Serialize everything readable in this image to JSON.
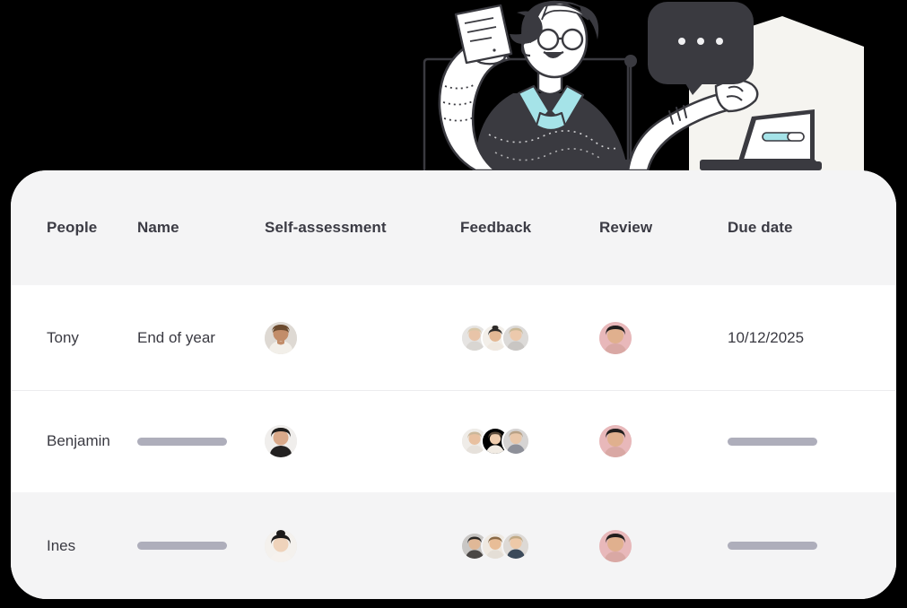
{
  "illustration": {
    "name": "person-reviewing-documents-illustration",
    "alt": "Illustration of a person with glasses holding a document at a desk with a laptop and a speech bubble",
    "colors": {
      "background": "#000000",
      "panel": "#f5f4f0",
      "ink": "#3a3a40",
      "accent_cyan": "#a5e3e8",
      "paper": "#ffffff"
    },
    "speech_bubble_dots": "• • •"
  },
  "table": {
    "columns": [
      {
        "key": "people",
        "label": "People"
      },
      {
        "key": "name",
        "label": "Name"
      },
      {
        "key": "self_assessment",
        "label": "Self-assessment"
      },
      {
        "key": "feedback",
        "label": "Feedback"
      },
      {
        "key": "review",
        "label": "Review"
      },
      {
        "key": "due_date",
        "label": "Due date"
      }
    ],
    "rows": [
      {
        "people": "Tony",
        "name": "End of year",
        "name_placeholder": false,
        "self_assessment_avatars": 1,
        "feedback_avatars": 3,
        "review_avatars": 1,
        "due_date": "10/12/2025",
        "due_date_placeholder": false,
        "highlighted": false
      },
      {
        "people": "Benjamin",
        "name": "",
        "name_placeholder": true,
        "self_assessment_avatars": 1,
        "feedback_avatars": 3,
        "review_avatars": 1,
        "due_date": "",
        "due_date_placeholder": true,
        "highlighted": false
      },
      {
        "people": "Ines",
        "name": "",
        "name_placeholder": true,
        "self_assessment_avatars": 1,
        "feedback_avatars": 3,
        "review_avatars": 1,
        "due_date": "",
        "due_date_placeholder": true,
        "highlighted": true
      }
    ]
  },
  "theme": {
    "card_background": "#ffffff",
    "header_background": "#f4f4f5",
    "row_highlight_background": "#f4f4f5",
    "divider": "#ececee",
    "text_primary": "#3a3a42",
    "text_header": "#3b3b44",
    "placeholder_bar": "#aeaebb",
    "page_background": "#000000"
  }
}
